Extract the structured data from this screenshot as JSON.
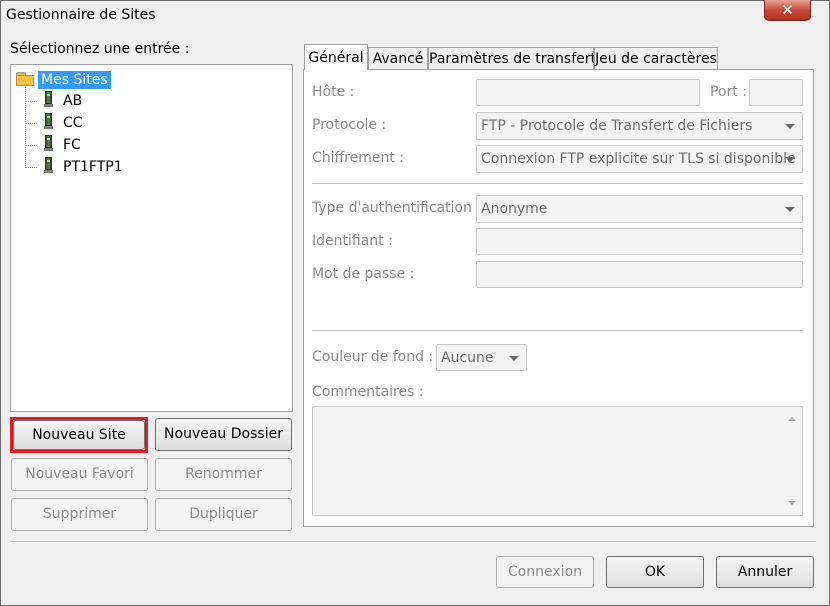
{
  "window": {
    "title": "Gestionnaire de Sites",
    "close_glyph": "✕"
  },
  "left": {
    "select_label": "Sélectionnez une entrée :",
    "tree": {
      "root": "Mes Sites",
      "sites": [
        "AB",
        "CC",
        "FC",
        "PT1FTP1"
      ]
    },
    "buttons": {
      "new_site": "Nouveau Site",
      "new_folder": "Nouveau Dossier",
      "new_bookmark": "Nouveau Favori",
      "rename": "Renommer",
      "delete": "Supprimer",
      "duplicate": "Dupliquer"
    }
  },
  "tabs": [
    "Général",
    "Avancé",
    "Paramètres de transfert",
    "Jeu de caractères"
  ],
  "general": {
    "host_label": "Hôte :",
    "host_value": "",
    "port_label": "Port :",
    "port_value": "",
    "protocol_label": "Protocole :",
    "protocol_value": "FTP - Protocole de Transfert de Fichiers",
    "encryption_label": "Chiffrement :",
    "encryption_value": "Connexion FTP explicite sur TLS si disponible",
    "auth_type_label": "Type d'authentification :",
    "auth_type_value": "Anonyme",
    "user_label": "Identifiant :",
    "user_value": "",
    "password_label": "Mot de passe :",
    "password_value": "",
    "bg_color_label": "Couleur de fond :",
    "bg_color_value": "Aucune",
    "comments_label": "Commentaires :"
  },
  "footer": {
    "connect": "Connexion",
    "ok": "OK",
    "cancel": "Annuler"
  },
  "colors": {
    "highlight": "#e21b23",
    "selection": "#3399ff",
    "disabled_text": "#8a8a8a"
  },
  "icons": {
    "folder": "folder-icon",
    "server": "server-icon",
    "close": "close-icon",
    "dropdown": "chevron-down-icon"
  }
}
